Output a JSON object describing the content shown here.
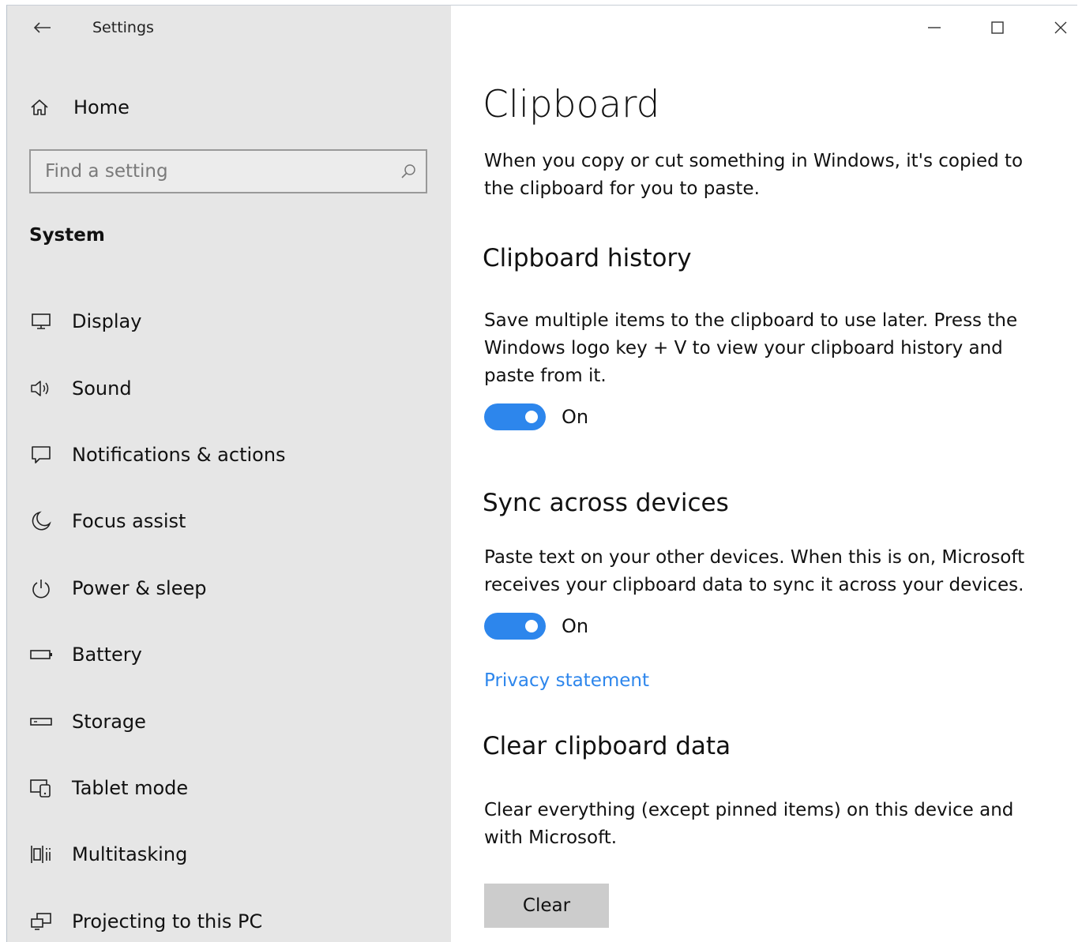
{
  "window": {
    "title": "Settings",
    "controls": [
      "minimize-icon",
      "maximize-icon",
      "close-icon"
    ]
  },
  "sidebar": {
    "home_label": "Home",
    "search_placeholder": "Find a setting",
    "section_label": "System",
    "items": [
      {
        "label": "Display",
        "icon": "display-icon"
      },
      {
        "label": "Sound",
        "icon": "speaker-icon"
      },
      {
        "label": "Notifications & actions",
        "icon": "notification-icon"
      },
      {
        "label": "Focus assist",
        "icon": "moon-icon"
      },
      {
        "label": "Power & sleep",
        "icon": "power-icon"
      },
      {
        "label": "Battery",
        "icon": "battery-icon"
      },
      {
        "label": "Storage",
        "icon": "storage-icon"
      },
      {
        "label": "Tablet mode",
        "icon": "tablet-mode-icon"
      },
      {
        "label": "Multitasking",
        "icon": "multitasking-icon"
      },
      {
        "label": "Projecting to this PC",
        "icon": "projecting-icon"
      }
    ]
  },
  "main": {
    "title": "Clipboard",
    "intro": "When you copy or cut something in Windows, it's copied to the clipboard for you to paste.",
    "history": {
      "heading": "Clipboard history",
      "description": "Save multiple items to the clipboard to use later. Press the Windows logo key + V to view your clipboard history and paste from it.",
      "toggle_state": "On",
      "enabled": true
    },
    "sync": {
      "heading": "Sync across devices",
      "description": "Paste text on your other devices. When this is on, Microsoft receives your clipboard data to sync it across your devices.",
      "toggle_state": "On",
      "enabled": true
    },
    "privacy_link": "Privacy statement",
    "clear": {
      "heading": "Clear clipboard data",
      "description": "Clear everything (except pinned items) on this device and with Microsoft.",
      "button_label": "Clear"
    }
  },
  "colors": {
    "sidebar_bg": "#e6e6e6",
    "accent": "#2d86ec",
    "button_bg": "#cccccc"
  }
}
